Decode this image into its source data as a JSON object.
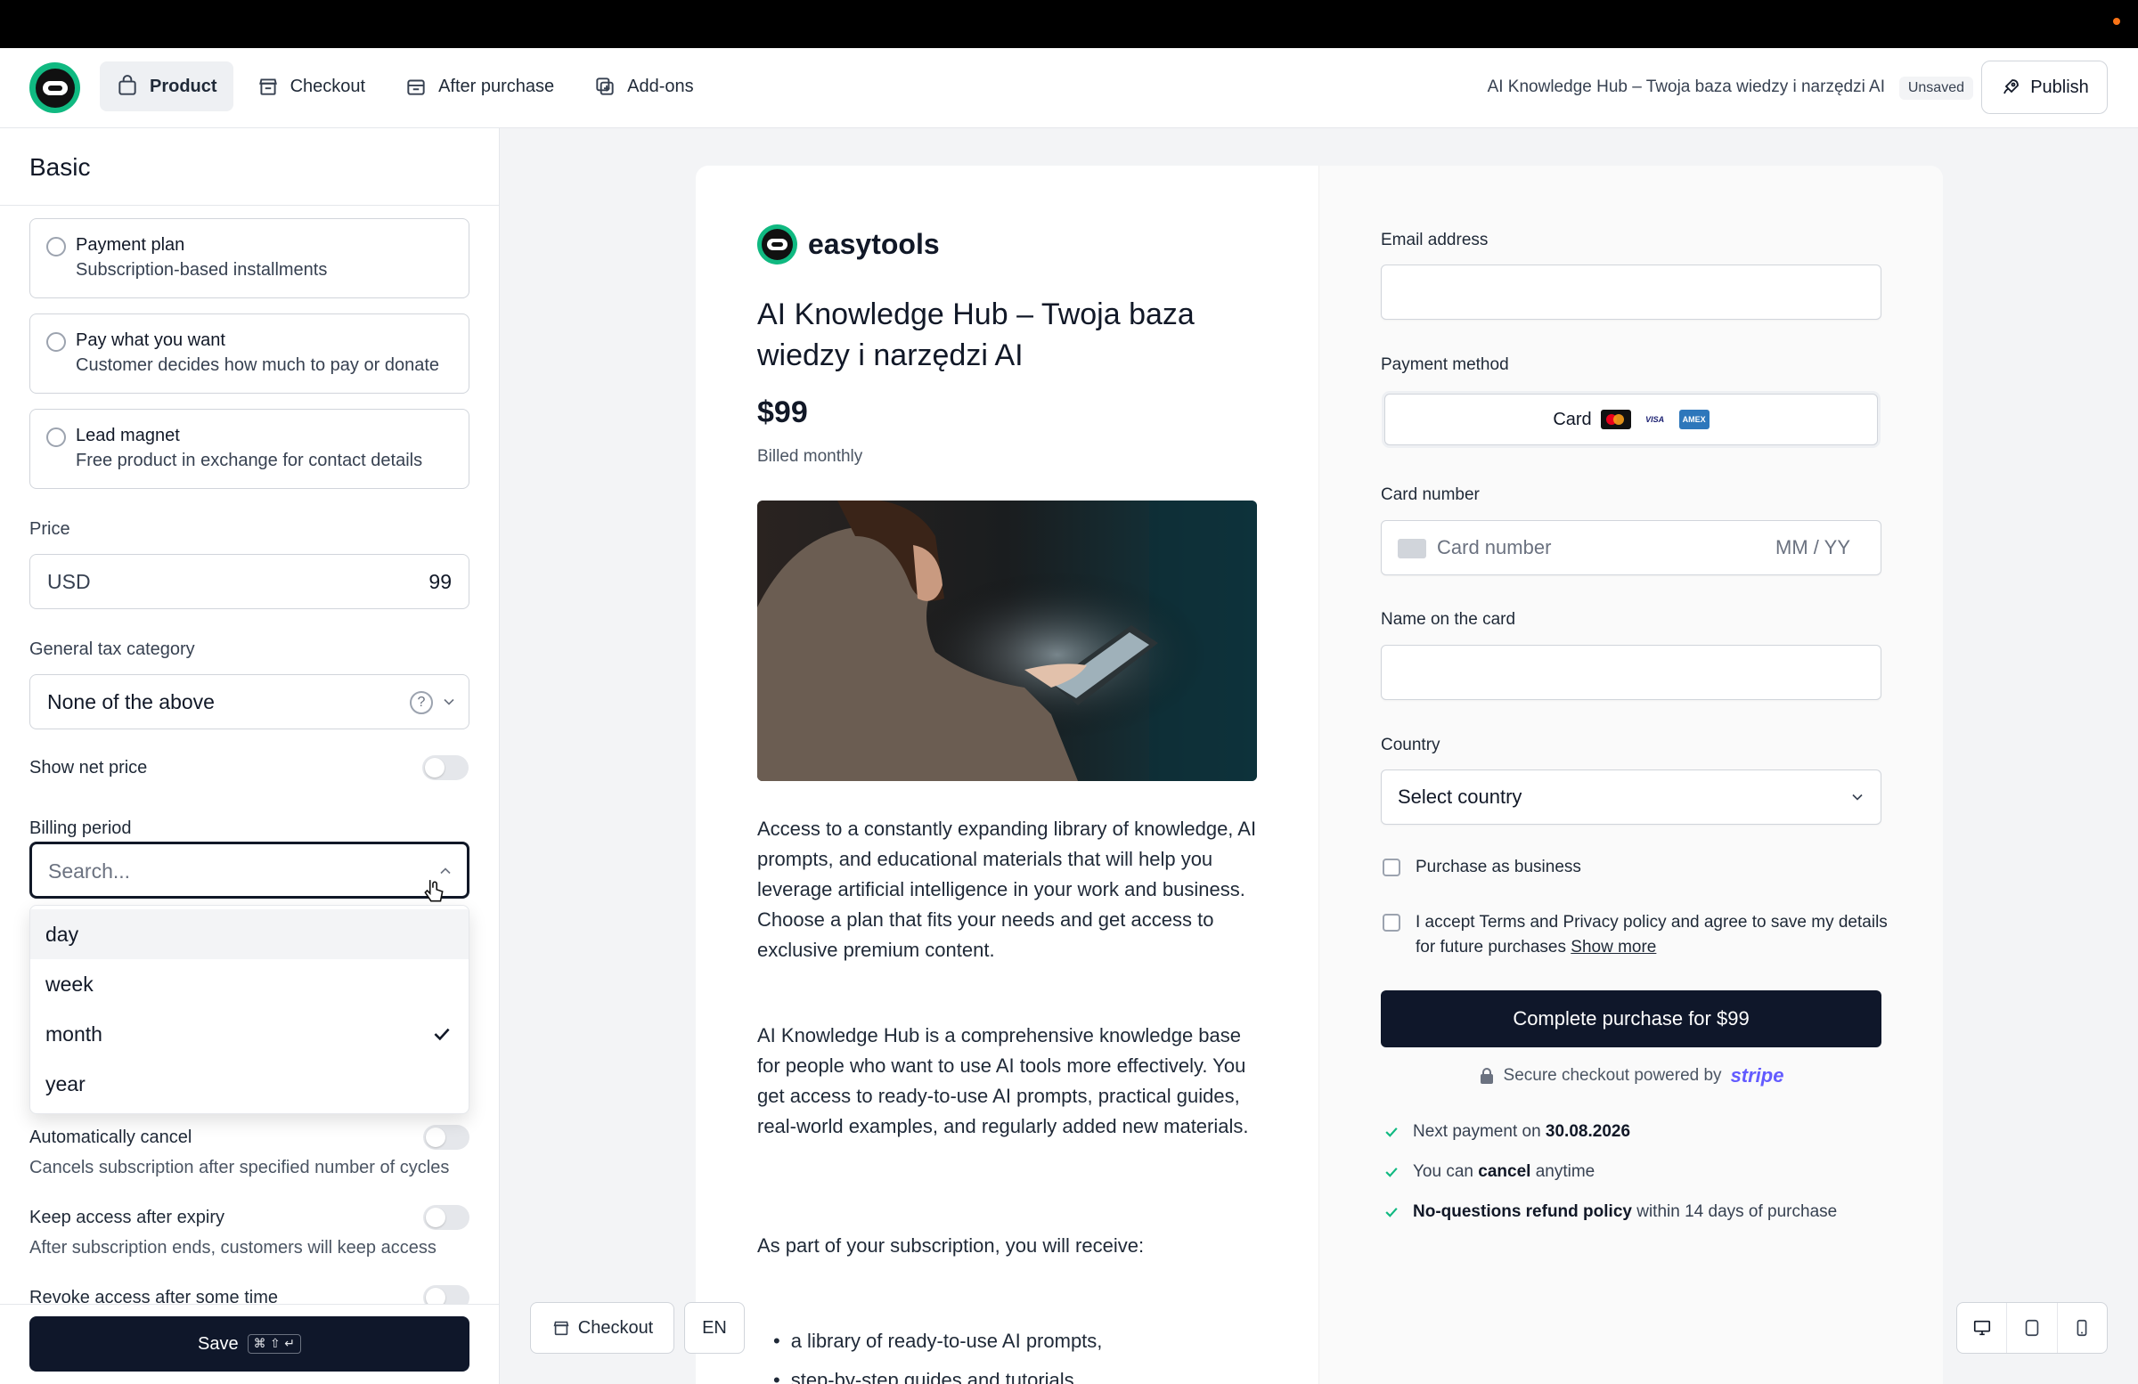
{
  "header": {
    "tabs": [
      {
        "label": "Product",
        "icon": "bag-icon",
        "active": true
      },
      {
        "label": "Checkout",
        "icon": "store-icon",
        "active": false
      },
      {
        "label": "After purchase",
        "icon": "gift-box-icon",
        "active": false
      },
      {
        "label": "Add-ons",
        "icon": "add-ons-icon",
        "active": false
      }
    ],
    "product_title": "AI Knowledge Hub – Twoja baza wiedzy i narzędzi AI",
    "status_badge": "Unsaved",
    "publish_label": "Publish"
  },
  "sidebar": {
    "section_title": "Basic",
    "pricing_options": [
      {
        "title": "Payment plan",
        "desc": "Subscription-based installments"
      },
      {
        "title": "Pay what you want",
        "desc": "Customer decides how much to pay or donate"
      },
      {
        "title": "Lead magnet",
        "desc": "Free product in exchange for contact details"
      }
    ],
    "price_label": "Price",
    "currency": "USD",
    "price_value": "99",
    "tax_label": "General tax category",
    "tax_value": "None of the above",
    "show_net_price_label": "Show net price",
    "billing_period_label": "Billing period",
    "billing_search_placeholder": "Search...",
    "billing_options": [
      {
        "label": "day",
        "selected": false
      },
      {
        "label": "week",
        "selected": false
      },
      {
        "label": "month",
        "selected": true
      },
      {
        "label": "year",
        "selected": false
      }
    ],
    "auto_cancel_label": "Automatically cancel",
    "auto_cancel_desc": "Cancels subscription after specified number of cycles",
    "keep_access_label": "Keep access after expiry",
    "keep_access_desc": "After subscription ends, customers will keep access",
    "revoke_access_label": "Revoke access after some time",
    "save_label": "Save",
    "save_shortcut": "⌘ ⇧ ↵"
  },
  "preview": {
    "brand_name": "easytools",
    "product_title": "AI Knowledge Hub – Twoja baza wiedzy i narzędzi AI",
    "price": "$99",
    "billing_note": "Billed monthly",
    "description_1": "Access to a constantly expanding library of knowledge, AI prompts, and educational materials that will help you leverage artificial intelligence in your work and business. Choose a plan that fits your needs and get access to exclusive premium content.",
    "description_2": "AI Knowledge Hub is a comprehensive knowledge base for people who want to use AI tools more effectively. You get access to ready-to-use AI prompts, practical guides, real-world examples, and regularly added new materials.",
    "description_3": "As part of your subscription, you will receive:",
    "bullets": [
      "a library of ready-to-use AI prompts,",
      "step-by-step guides and tutorials,"
    ],
    "checkout_button": "Checkout",
    "language_button": "EN"
  },
  "checkout_form": {
    "email_label": "Email address",
    "payment_method_label": "Payment method",
    "payment_method_value": "Card",
    "card_number_label": "Card number",
    "card_number_placeholder": "Card number",
    "expiry_placeholder": "MM / YY",
    "name_label": "Name on the card",
    "country_label": "Country",
    "country_value": "Select country",
    "business_label": "Purchase as business",
    "terms_text": "I accept Terms and Privacy policy and agree to save my details for future purchases",
    "show_more": "Show more",
    "purchase_button": "Complete purchase for $99",
    "secure_text": "Secure checkout powered by",
    "stripe_brand": "stripe",
    "perks": [
      {
        "pre": "Next payment on ",
        "bold": "30.08.2026",
        "post": ""
      },
      {
        "pre": "You can ",
        "bold": "cancel",
        "post": " anytime"
      },
      {
        "pre": "",
        "bold": "No-questions refund policy",
        "post": " within 14 days of purchase"
      }
    ]
  },
  "colors": {
    "accent_dark": "#0f172a",
    "brand_green": "#10b981",
    "check_green": "#10b981",
    "stripe_purple": "#635bff"
  }
}
